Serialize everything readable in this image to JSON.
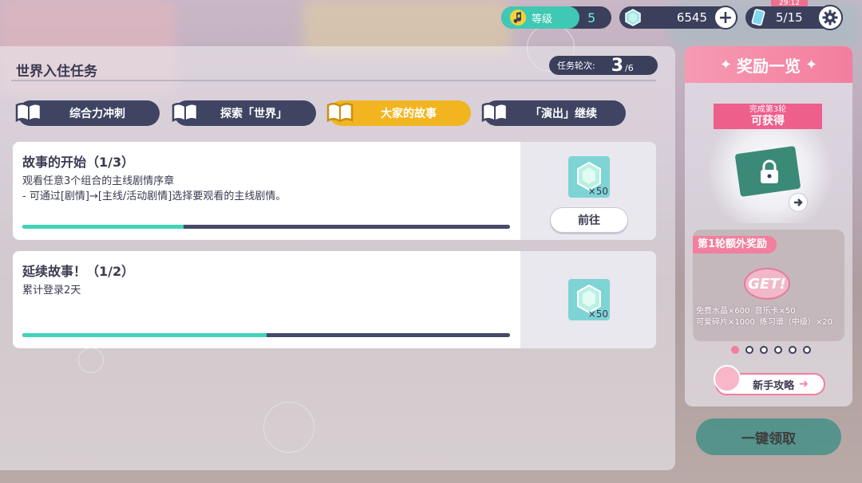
{
  "topbar": {
    "level_label": "等级",
    "level_value": "5",
    "gems": "6545",
    "ticket_timer": "29:12",
    "tickets": "5/15"
  },
  "main": {
    "title": "世界入住任务",
    "round_label": "任务轮次:",
    "round_current": "3",
    "round_total": "/6",
    "tabs": [
      {
        "label": "综合力冲刺",
        "active": false
      },
      {
        "label": "探索「世界」",
        "active": false
      },
      {
        "label": "大家的故事",
        "active": true
      },
      {
        "label": "「演出」继续",
        "active": false
      }
    ],
    "missions": [
      {
        "title": "故事的开始（1/3）",
        "desc_line1": "观看任意3个组合的主线剧情序章",
        "desc_line2": "- 可通过[剧情]→[主线/活动剧情]选择要观看的主线剧情。",
        "progress": 0.33,
        "reward_count": "×50",
        "button_label": "前往"
      },
      {
        "title": "延续故事！（1/2）",
        "desc_line1": "累计登录2天",
        "progress": 0.5,
        "reward_count": "×50"
      }
    ]
  },
  "side": {
    "header": "奖励一览",
    "ribbon_small": "完成第3轮",
    "ribbon_big": "可获得",
    "bonus_label": "第1轮额外奖励",
    "get_text": "GET!",
    "bonus_items": [
      "免费水晶×600",
      "音乐卡×50",
      "可爱碎片×1000",
      "练习谱（中级）×20"
    ],
    "guide_label": "新手攻略",
    "claim_all": "一键领取"
  },
  "colors": {
    "accent_teal": "#42d2b8",
    "tab_active": "#f2b51f",
    "pink": "#f37e9d",
    "navy": "#3a3f5c"
  }
}
